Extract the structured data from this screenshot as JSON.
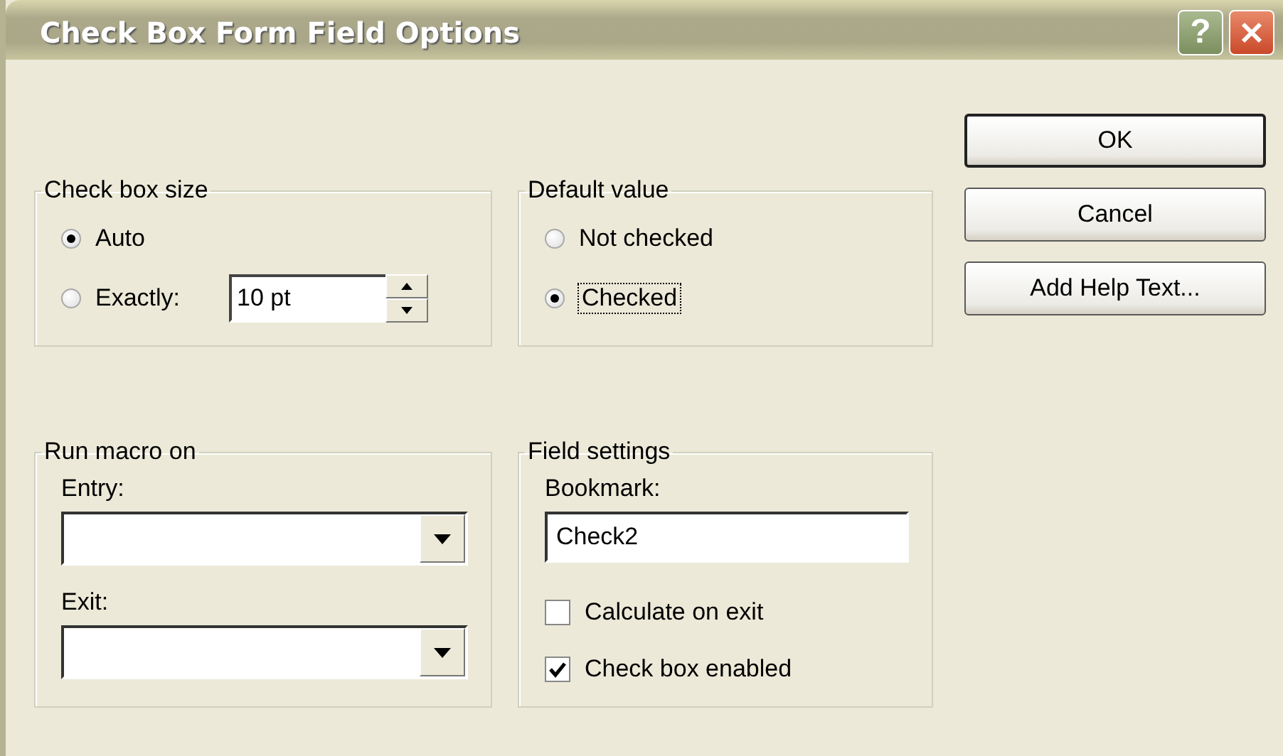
{
  "window": {
    "title": "Check Box Form Field Options",
    "title_buttons": [
      {
        "kind": "help",
        "label": "?"
      },
      {
        "kind": "close"
      }
    ]
  },
  "check_box_size": {
    "title": "Check box size",
    "options": [
      {
        "label": "Auto",
        "selected": true
      },
      {
        "label": "Exactly:",
        "selected": false
      }
    ],
    "size_field": {
      "value": "10 pt"
    }
  },
  "default_value": {
    "title": "Default value",
    "options": [
      {
        "label": "Not checked",
        "selected": false,
        "focused": false
      },
      {
        "label": "Checked",
        "selected": true,
        "focused": true
      }
    ]
  },
  "run_macro_on": {
    "title": "Run macro on",
    "fields": [
      {
        "label": "Entry:"
      },
      {
        "label": "Exit:"
      }
    ]
  },
  "field_settings": {
    "title": "Field settings",
    "bookmark_label": "Bookmark:",
    "bookmark_value": "Check2",
    "checkboxes": [
      {
        "label": "Calculate on exit",
        "checked": false
      },
      {
        "label": "Check box enabled",
        "checked": true
      }
    ]
  },
  "buttons": [
    {
      "label": "OK",
      "default": true
    },
    {
      "label": "Cancel",
      "default": false
    },
    {
      "label": "Add Help Text...",
      "default": false
    }
  ]
}
